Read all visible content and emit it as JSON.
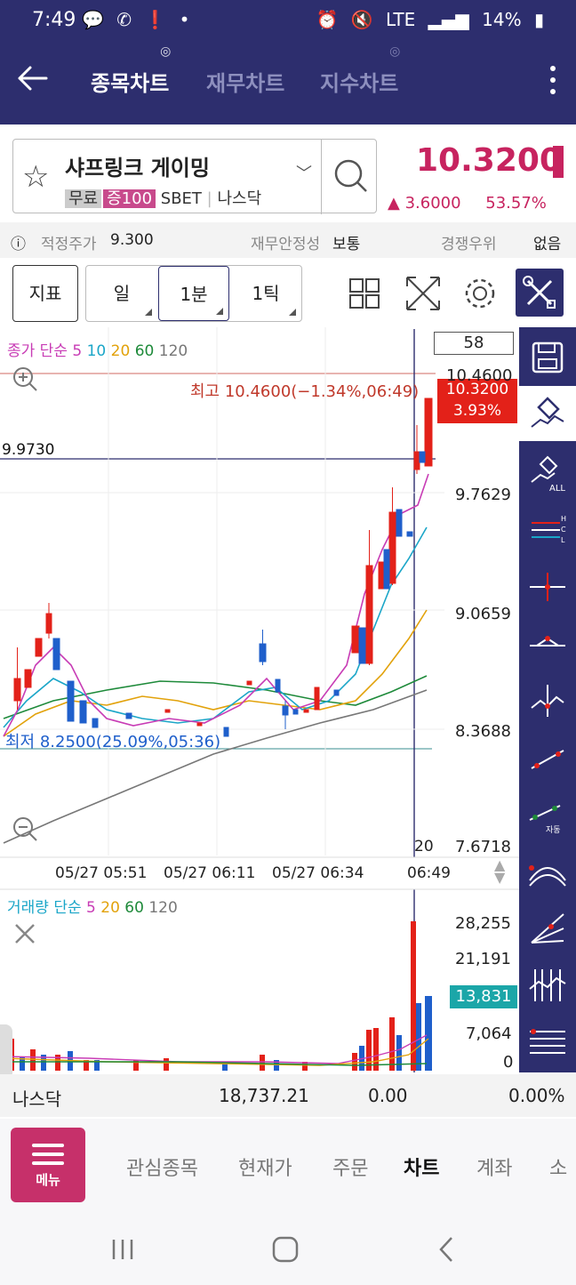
{
  "status": {
    "time": "7:49",
    "battery": "14%",
    "network": "LTE"
  },
  "header": {
    "tabs": [
      {
        "label": "종목차트",
        "active": true
      },
      {
        "label": "재무차트",
        "active": false
      },
      {
        "label": "지수차트",
        "active": false
      }
    ]
  },
  "stock": {
    "name": "샤프링크 게이밍",
    "tag_free": "무료",
    "tag_margin": "증100",
    "ticker": "SBET",
    "market": "나스닥",
    "price": "10.3200",
    "change": "▲ 3.6000",
    "change_pct": "53.57%"
  },
  "info": {
    "fair_label": "적정주가",
    "fair_value": "9.300",
    "stability_label": "재무안정성",
    "stability_value": "보통",
    "competition_label": "경쟁우위",
    "competition_value": "없음"
  },
  "toolbar": {
    "indicator": "지표",
    "period_day": "일",
    "period_min": "1분",
    "period_tick": "1틱"
  },
  "chart": {
    "count_box": "58",
    "price_legend": {
      "label": "종가 단순",
      "ma": [
        "5",
        "10",
        "20",
        "60",
        "120"
      ]
    },
    "volume_legend": {
      "label": "거래량 단순",
      "ma": [
        "5",
        "20",
        "60",
        "120"
      ]
    },
    "high_note": "최고 10.4600(−1.34%,06:49)",
    "low_note": "최저 8.2500(25.09%,05:36)",
    "crosshair_price": "9.9730",
    "current_price": "10.3200",
    "current_pct": "3.93%",
    "y_ticks": [
      "10.4600",
      "9.7629",
      "9.0659",
      "8.3688",
      "7.6718"
    ],
    "x_ticks": [
      "05/27 05:51",
      "05/27 06:11",
      "05/27 06:34",
      "06:49"
    ],
    "crosshair_x_label": "20",
    "vol_ticks": [
      "28,255",
      "21,191",
      "7,064",
      "0"
    ],
    "vol_current": "13,831",
    "colors": {
      "up": "#e32119",
      "down": "#1f5fcb",
      "ma5": "#c83cb5",
      "ma10": "#1ba6c8",
      "ma20": "#e2a20b",
      "ma60": "#1e8a3a",
      "ma120": "#777777"
    }
  },
  "chart_data": {
    "type": "candlestick",
    "ylim": [
      7.6718,
      10.46
    ],
    "candles": [
      {
        "o": 8.3,
        "h": 8.4,
        "l": 8.25,
        "c": 8.35,
        "up": true
      },
      {
        "o": 8.35,
        "h": 8.5,
        "l": 8.3,
        "c": 8.45,
        "up": true
      },
      {
        "o": 8.45,
        "h": 8.6,
        "l": 8.4,
        "c": 8.55,
        "up": true
      },
      {
        "o": 8.55,
        "h": 8.95,
        "l": 8.5,
        "c": 8.9,
        "up": true
      },
      {
        "o": 8.7,
        "h": 8.85,
        "l": 8.65,
        "c": 8.8,
        "up": true
      },
      {
        "o": 8.75,
        "h": 9.0,
        "l": 8.7,
        "c": 8.95,
        "up": true
      },
      {
        "o": 8.95,
        "h": 9.1,
        "l": 8.9,
        "c": 9.05,
        "up": true
      },
      {
        "o": 9.05,
        "h": 9.1,
        "l": 8.8,
        "c": 8.85,
        "up": false
      },
      {
        "o": 8.85,
        "h": 8.9,
        "l": 8.7,
        "c": 8.75,
        "up": false
      },
      {
        "o": 8.75,
        "h": 8.8,
        "l": 8.4,
        "c": 8.45,
        "up": false
      },
      {
        "o": 8.45,
        "h": 8.55,
        "l": 8.35,
        "c": 8.5,
        "up": false
      },
      {
        "o": 8.5,
        "h": 8.55,
        "l": 8.4,
        "c": 8.45,
        "up": false
      }
    ],
    "volume_max": 28255
  }
}
